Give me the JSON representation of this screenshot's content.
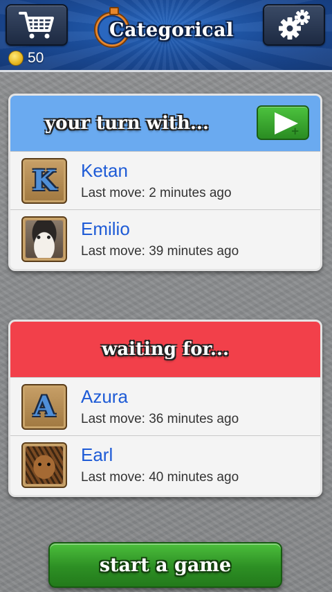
{
  "header": {
    "app_title": "Categorical",
    "coins": "50",
    "cart_icon": "shopping-cart-icon",
    "settings_icon": "gears-icon"
  },
  "your_turn": {
    "title": "your turn with...",
    "players": [
      {
        "name": "Ketan",
        "last_move": "Last move: 2 minutes ago",
        "avatar": {
          "type": "letter",
          "letter": "K"
        }
      },
      {
        "name": "Emilio",
        "last_move": "Last move: 39 minutes ago",
        "avatar": {
          "type": "photo",
          "subject": "white-black cat"
        }
      }
    ]
  },
  "waiting": {
    "title": "waiting for...",
    "players": [
      {
        "name": "Azura",
        "last_move": "Last move: 36 minutes ago",
        "avatar": {
          "type": "letter",
          "letter": "A"
        }
      },
      {
        "name": "Earl",
        "last_move": "Last move: 40 minutes ago",
        "avatar": {
          "type": "photo",
          "subject": "tabby cat"
        }
      }
    ]
  },
  "start_button": {
    "label": "start a game"
  },
  "colors": {
    "turn_header": "#6aaaf0",
    "waiting_header": "#f2404a",
    "start_button": "#2d8f24",
    "player_name": "#1e5bd6"
  }
}
